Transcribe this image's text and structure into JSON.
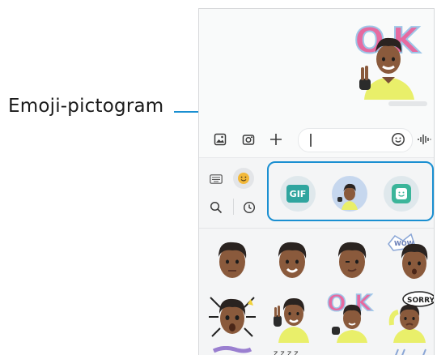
{
  "callout": {
    "label": "Emoji-pictogram"
  },
  "conversation": {
    "sticker": "ok-sticker-avatar"
  },
  "input_bar": {
    "icons": [
      "gallery-icon",
      "camera-icon",
      "add-icon",
      "emoji-icon",
      "voice-icon"
    ],
    "text_value": ""
  },
  "keyboard_panel": {
    "categories": [
      "keyboard-icon",
      "emoji-face-icon",
      "search-icon",
      "recent-icon"
    ],
    "types": [
      {
        "name": "gif",
        "label": "GIF"
      },
      {
        "name": "ar-emoji-avatar",
        "label": ""
      },
      {
        "name": "bitmoji-sticker",
        "label": ""
      }
    ],
    "stickers": [
      "avatar-neutral",
      "avatar-smile",
      "avatar-wink",
      "avatar-wow",
      "avatar-shock",
      "avatar-wave",
      "avatar-ok",
      "avatar-sorry"
    ]
  },
  "colors": {
    "accent": "#1a8fd1",
    "gif": "#2fa59f",
    "bitmoji": "#3bb59a"
  }
}
